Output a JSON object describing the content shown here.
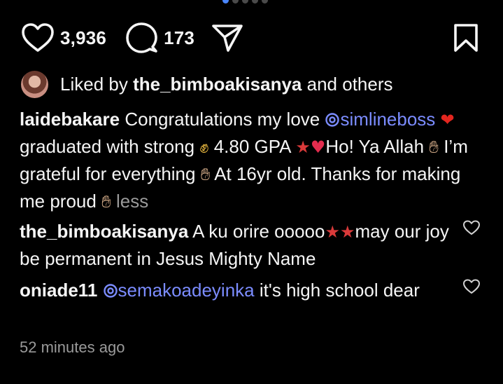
{
  "carousel": {
    "count": 5,
    "active": 0
  },
  "actions": {
    "like_count": "3,936",
    "comment_count": "173"
  },
  "liked_by": {
    "prefix": "Liked by",
    "user": "the_bimboakisanya",
    "suffix": "and others"
  },
  "caption": {
    "user": "laidebakare",
    "seg1": "Congratulations my love",
    "mention": "simlineboss",
    "seg2": "graduated with strong",
    "seg3": "4.80 GPA",
    "seg4": "Ho! Ya Allah",
    "seg5": "I’m grateful for everything",
    "seg6": "At 16yr old. Thanks  for making me proud",
    "less": "less"
  },
  "comments": [
    {
      "user": "the_bimboakisanya",
      "text1": "A ku orire ooooo",
      "text2": "may our joy be permanent in Jesus Mighty Name"
    },
    {
      "user": "oniade11",
      "mention": "semakoadeyinka",
      "text": "it's high school dear"
    }
  ],
  "timestamp": "52 minutes ago",
  "icons": {
    "like": "heart-outline-icon",
    "comment": "comment-bubble-icon",
    "share": "paper-plane-icon",
    "save": "bookmark-icon",
    "mention_color": "#7b8cff"
  }
}
